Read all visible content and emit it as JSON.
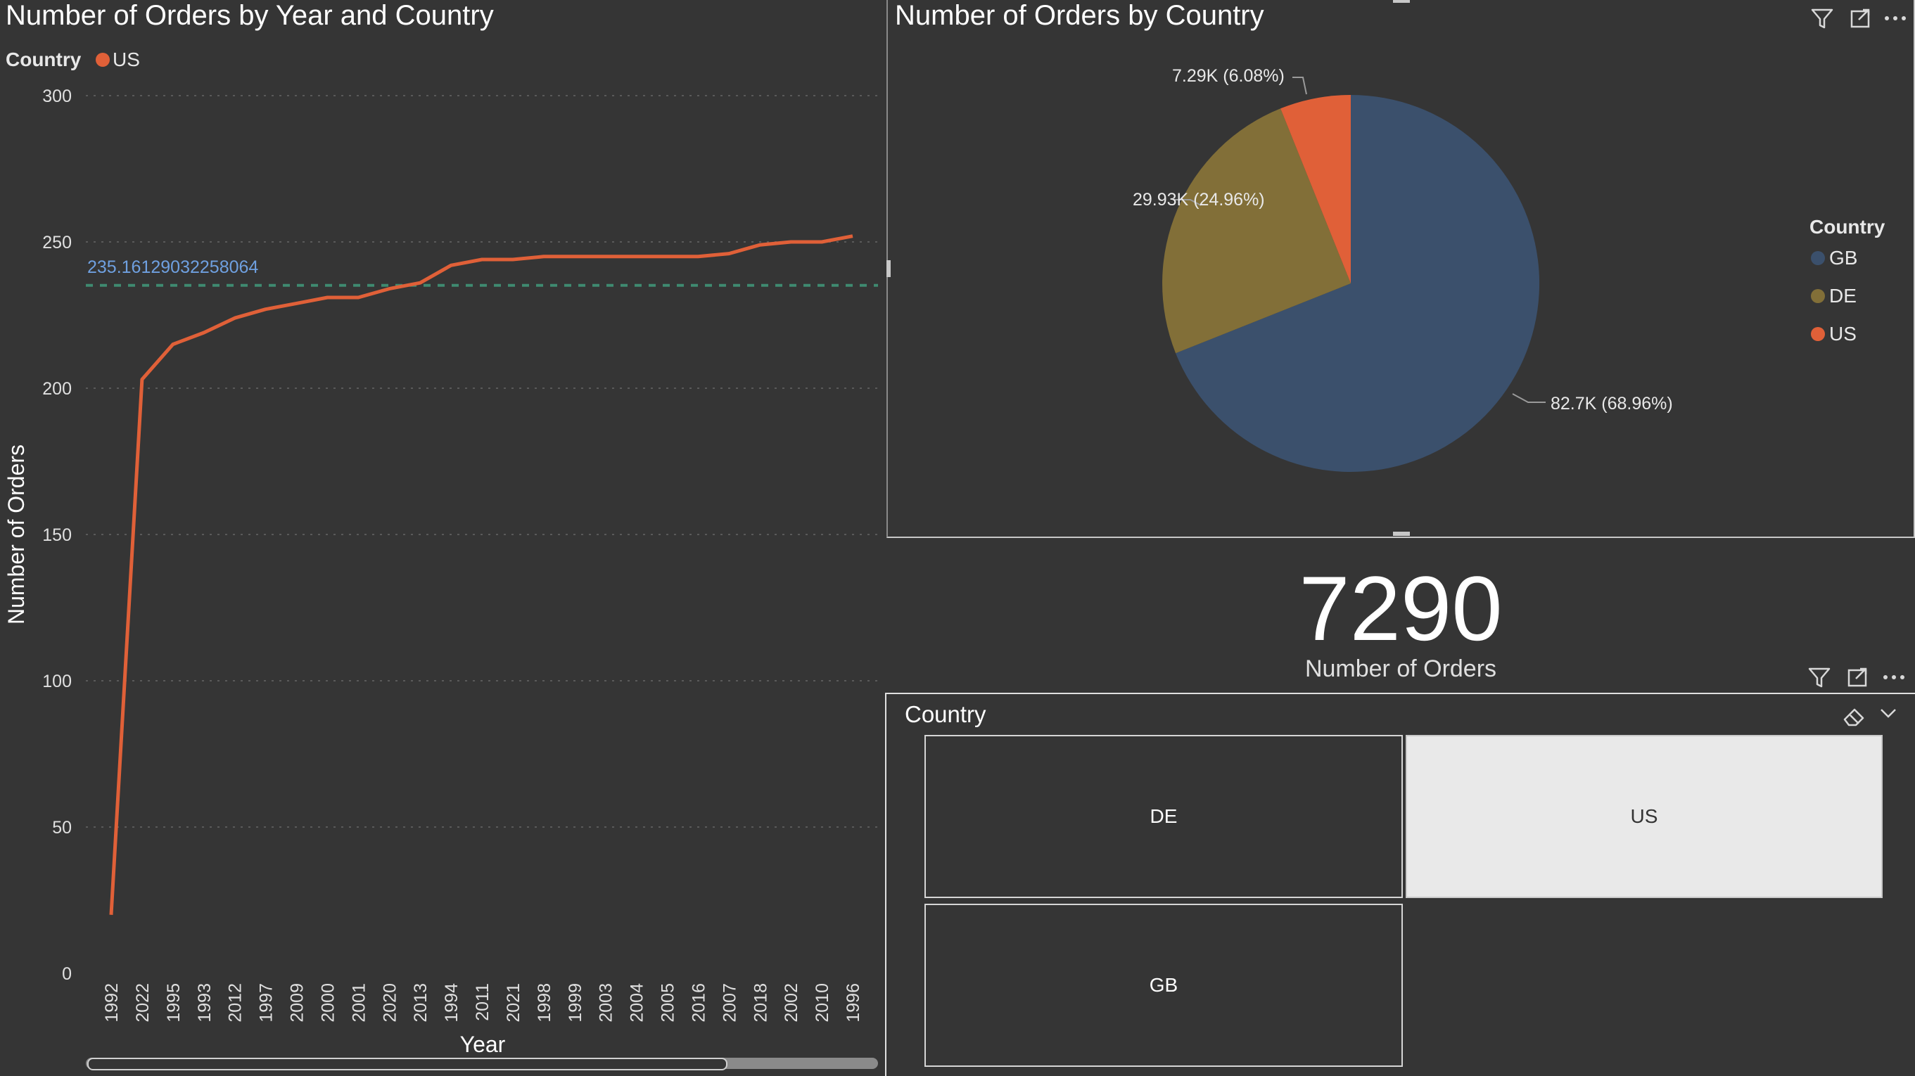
{
  "line_chart": {
    "title": "Number of Orders by Year and Country",
    "legend_title": "Country",
    "legend_items": [
      {
        "label": "US",
        "color": "#e06038"
      }
    ],
    "xlabel": "Year",
    "ylabel": "Number of Orders",
    "avg_label": "235.16129032258064"
  },
  "pie_chart": {
    "title": "Number of Orders by Country",
    "legend_title": "Country",
    "legend_items": [
      {
        "label": "GB",
        "color": "#3b506c"
      },
      {
        "label": "DE",
        "color": "#826f38"
      },
      {
        "label": "US",
        "color": "#e06038"
      }
    ],
    "data_labels": [
      "82.7K (68.96%)",
      "29.93K (24.96%)",
      "7.29K (6.08%)"
    ]
  },
  "card": {
    "value": "7290",
    "label": "Number of Orders"
  },
  "slicer": {
    "title": "Country",
    "tiles": [
      {
        "label": "DE",
        "selected": false
      },
      {
        "label": "US",
        "selected": true
      },
      {
        "label": "GB",
        "selected": false
      }
    ]
  },
  "icons": [
    "filter-icon",
    "focus-mode-icon",
    "more-options-icon",
    "eraser-icon",
    "chevron-down-icon"
  ],
  "chart_data": [
    {
      "type": "line",
      "title": "Number of Orders by Year and Country",
      "xlabel": "Year",
      "ylabel": "Number of Orders",
      "ylim": [
        0,
        300
      ],
      "yticks": [
        0,
        50,
        100,
        150,
        200,
        250,
        300
      ],
      "categories": [
        "1992",
        "2022",
        "1995",
        "1993",
        "2012",
        "1997",
        "2009",
        "2000",
        "2001",
        "2020",
        "2013",
        "1994",
        "2011",
        "2021",
        "1998",
        "1999",
        "2003",
        "2004",
        "2005",
        "2016",
        "2007",
        "2018",
        "2002",
        "2010",
        "1996"
      ],
      "series": [
        {
          "name": "US",
          "color": "#e06038",
          "values": [
            20,
            203,
            215,
            219,
            224,
            227,
            229,
            231,
            231,
            234,
            236,
            242,
            244,
            244,
            245,
            245,
            245,
            245,
            245,
            245,
            246,
            249,
            250,
            250,
            252
          ]
        }
      ],
      "average_line": 235.16129032258064,
      "grid": true,
      "legend_position": "top-left"
    },
    {
      "type": "pie",
      "title": "Number of Orders by Country",
      "categories": [
        "GB",
        "DE",
        "US"
      ],
      "values": [
        82700,
        29930,
        7290
      ],
      "percentages": [
        68.96,
        24.96,
        6.08
      ],
      "colors": [
        "#3b506c",
        "#826f38",
        "#e06038"
      ],
      "legend_position": "right"
    }
  ]
}
